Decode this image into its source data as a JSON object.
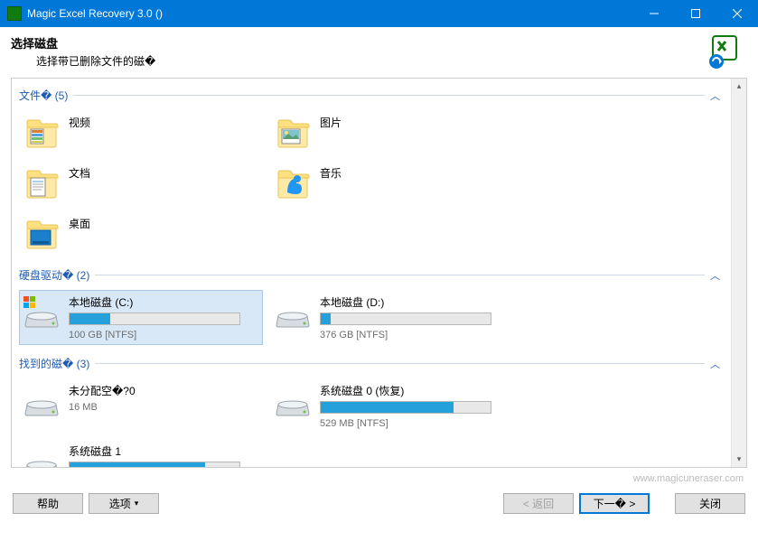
{
  "window": {
    "title": "Magic Excel Recovery 3.0 ()"
  },
  "header": {
    "title": "选择磁盘",
    "subtitle": "选择带已删除文件的磁�"
  },
  "groups": {
    "files": {
      "label": "文件�",
      "count": "(5)"
    },
    "drives": {
      "label": "硬盘驱动�",
      "count": "(2)"
    },
    "found": {
      "label": "找到的磁�",
      "count": "(3)"
    }
  },
  "folders": [
    {
      "label": "视频"
    },
    {
      "label": "图片"
    },
    {
      "label": "文档"
    },
    {
      "label": "音乐"
    },
    {
      "label": "桌面"
    }
  ],
  "disks": [
    {
      "label": "本地磁盘 (C:)",
      "size": "100 GB [NTFS]",
      "fill": 24,
      "selected": true,
      "os": true
    },
    {
      "label": "本地磁盘 (D:)",
      "size": "376 GB [NTFS]",
      "fill": 6
    }
  ],
  "found_disks": [
    {
      "label": "未分配空�?0",
      "size": "16 MB",
      "fill": 0,
      "noProgress": true
    },
    {
      "label": "系统磁盘 0 (恢复)",
      "size": "529 MB [NTFS]",
      "fill": 78
    },
    {
      "label": "系统磁盘 1",
      "size": "",
      "fill": 80
    }
  ],
  "footer": {
    "url": "www.magicuneraser.com",
    "help": "帮助",
    "options": "选项",
    "back": "< 返回",
    "next": "下一�",
    "close": "关闭"
  }
}
